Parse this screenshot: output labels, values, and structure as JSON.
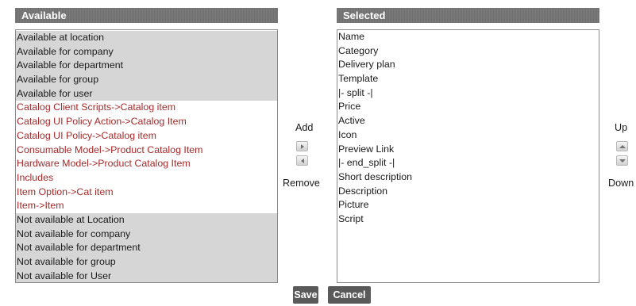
{
  "available": {
    "header": "Available",
    "items": [
      {
        "label": "Available at location",
        "style": "gray"
      },
      {
        "label": "Available for company",
        "style": "gray"
      },
      {
        "label": "Available for department",
        "style": "gray"
      },
      {
        "label": "Available for group",
        "style": "gray"
      },
      {
        "label": "Available for user",
        "style": "gray"
      },
      {
        "label": "Catalog Client Scripts->Catalog item",
        "style": "red"
      },
      {
        "label": "Catalog UI Policy Action->Catalog Item",
        "style": "red"
      },
      {
        "label": "Catalog UI Policy->Catalog item",
        "style": "red"
      },
      {
        "label": "Consumable Model->Product Catalog Item",
        "style": "red"
      },
      {
        "label": "Hardware Model->Product Catalog Item",
        "style": "red"
      },
      {
        "label": "Includes",
        "style": "red"
      },
      {
        "label": "Item Option->Cat item",
        "style": "red"
      },
      {
        "label": "Item->Item",
        "style": "red"
      },
      {
        "label": "Not available at Location",
        "style": "gray"
      },
      {
        "label": "Not available for company",
        "style": "gray"
      },
      {
        "label": "Not available for department",
        "style": "gray"
      },
      {
        "label": "Not available for group",
        "style": "gray"
      },
      {
        "label": "Not available for User",
        "style": "gray"
      }
    ]
  },
  "selected": {
    "header": "Selected",
    "items": [
      "Name",
      "Category",
      "Delivery plan",
      "Template",
      "|- split -|",
      "Price",
      "Active",
      "Icon",
      "Preview Link",
      "|- end_split -|",
      "Short description",
      "Description",
      "Picture",
      "Script"
    ]
  },
  "transfer": {
    "add_label": "Add",
    "remove_label": "Remove",
    "add_icon": "arrow-right-icon",
    "remove_icon": "arrow-left-icon"
  },
  "ordering": {
    "up_label": "Up",
    "down_label": "Down",
    "up_icon": "arrow-up-icon",
    "down_icon": "arrow-down-icon"
  },
  "actions": {
    "save_label": "Save",
    "cancel_label": "Cancel"
  },
  "colors": {
    "header_bg": "#707070",
    "group_bg": "#d6d6d6",
    "related_list_text": "#a52a2a",
    "button_bg": "#5a5a5a"
  }
}
